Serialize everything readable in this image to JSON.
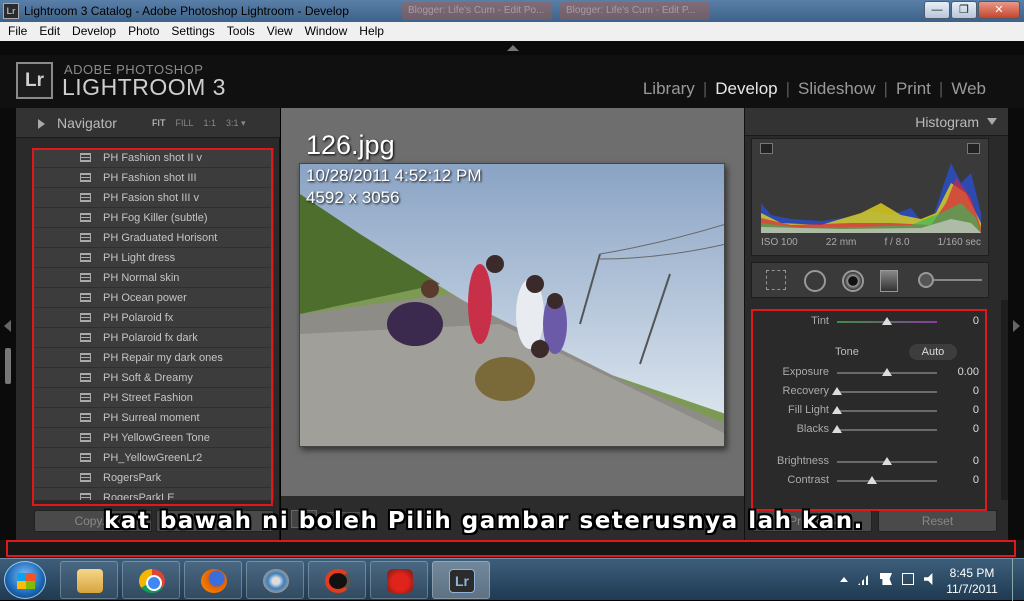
{
  "window": {
    "title": "Lightroom 3 Catalog - Adobe Photoshop Lightroom - Develop",
    "app_icon": "Lr",
    "background_tabs": [
      "Blogger: Life's Cum - Edit Po...",
      "Blogger: Life's Cum - Edit P..."
    ],
    "controls": {
      "minimize": "—",
      "maximize": "❐",
      "close": "✕"
    }
  },
  "menu": [
    "File",
    "Edit",
    "Develop",
    "Photo",
    "Settings",
    "Tools",
    "View",
    "Window",
    "Help"
  ],
  "identity_plate": {
    "badge": "Lr",
    "line1": "ADOBE PHOTOSHOP",
    "line2": "LIGHTROOM 3"
  },
  "modules": {
    "items": [
      "Library",
      "Develop",
      "Slideshow",
      "Print",
      "Web"
    ],
    "active": "Develop",
    "separator": "|"
  },
  "navigator": {
    "label": "Navigator",
    "zoom_options": [
      "FIT",
      "FILL",
      "1:1",
      "3:1 ▾"
    ],
    "active_zoom": "FIT"
  },
  "presets": [
    "PH Fashion shot II v",
    "PH Fashion shot III",
    "PH Fasion shot III v",
    "PH Fog Killer (subtle)",
    "PH Graduated Horisont",
    "PH Light dress",
    "PH Normal skin",
    "PH Ocean power",
    "PH Polaroid fx",
    "PH Polaroid fx dark",
    "PH Repair my dark ones",
    "PH Soft & Dreamy",
    "PH Street Fashion",
    "PH Surreal moment",
    "PH YellowGreen Tone",
    "PH_YellowGreenLr2",
    "RogersPark",
    "RogersParkLE"
  ],
  "left_buttons": {
    "copy": "Copy...",
    "paste": "Paste"
  },
  "photo": {
    "filename": "126.jpg",
    "datetime": "10/28/2011 4:52:12 PM",
    "dimensions": "4592 x 3056"
  },
  "histogram": {
    "label": "Histogram",
    "iso": "ISO 100",
    "focal": "22 mm",
    "aperture": "f / 8.0",
    "shutter": "1/160 sec"
  },
  "basic": {
    "tint": {
      "label": "Tint",
      "value": "0",
      "pos": 0.5
    },
    "tone_label": "Tone",
    "auto_label": "Auto",
    "sliders": [
      {
        "label": "Exposure",
        "value": "0.00",
        "pos": 0.5
      },
      {
        "label": "Recovery",
        "value": "0",
        "pos": 0.0
      },
      {
        "label": "Fill Light",
        "value": "0",
        "pos": 0.0
      },
      {
        "label": "Blacks",
        "value": "0",
        "pos": 0.0
      }
    ],
    "presence": [
      {
        "label": "Brightness",
        "value": "0",
        "pos": 0.5
      },
      {
        "label": "Contrast",
        "value": "0",
        "pos": 0.35
      }
    ]
  },
  "right_buttons": {
    "previous": "Previous",
    "reset": "Reset"
  },
  "caption": "kat bawah ni boleh Pilih gambar seterusnya lah kan.",
  "taskbar": {
    "lr_label": "Lr",
    "time": "8:45 PM",
    "date": "11/7/2011"
  },
  "colors": {
    "annotation_red": "#e0181c",
    "panel": "#2a2a2a",
    "center_bg": "#6e6e6e",
    "taskbar": "#1f3a52"
  }
}
